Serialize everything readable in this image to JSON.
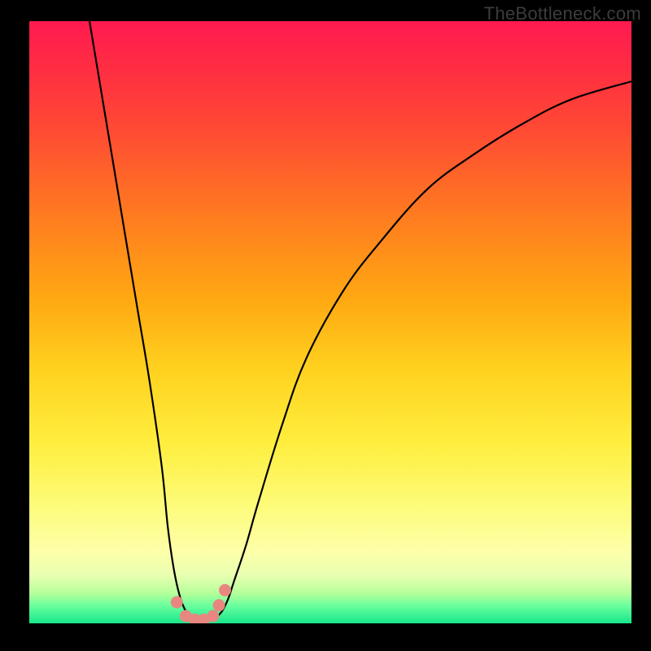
{
  "attribution": "TheBottleneck.com",
  "chart_data": {
    "type": "line",
    "title": "",
    "xlabel": "",
    "ylabel": "",
    "xlim": [
      0,
      100
    ],
    "ylim": [
      0,
      100
    ],
    "grid": false,
    "legend": false,
    "series": [
      {
        "name": "left-branch",
        "x": [
          10,
          12,
          14,
          16,
          18,
          20,
          22,
          23,
          24,
          25,
          26,
          27,
          28
        ],
        "values": [
          100,
          88,
          76,
          64,
          52,
          40,
          26,
          16,
          9,
          4.5,
          2,
          1,
          0.5
        ],
        "color": "#000000"
      },
      {
        "name": "right-branch",
        "x": [
          30,
          31,
          32,
          33,
          34,
          36,
          38,
          42,
          46,
          52,
          58,
          66,
          74,
          82,
          90,
          100
        ],
        "values": [
          0.5,
          1,
          2,
          4,
          7,
          13,
          20,
          33,
          44,
          55,
          63,
          72,
          78,
          83,
          87,
          90
        ],
        "color": "#000000"
      },
      {
        "name": "bottom-markers",
        "marker_color": "#e8877f",
        "points": [
          {
            "x": 24.5,
            "y": 3.5
          },
          {
            "x": 26,
            "y": 1.2
          },
          {
            "x": 27.5,
            "y": 0.6
          },
          {
            "x": 29,
            "y": 0.6
          },
          {
            "x": 30.5,
            "y": 1.2
          },
          {
            "x": 31.5,
            "y": 3.0
          },
          {
            "x": 32.5,
            "y": 5.5
          }
        ]
      }
    ],
    "background_gradient": {
      "top_color": "#ff1a50",
      "mid_color": "#ffd21f",
      "bottom_color": "#17e78c"
    }
  }
}
